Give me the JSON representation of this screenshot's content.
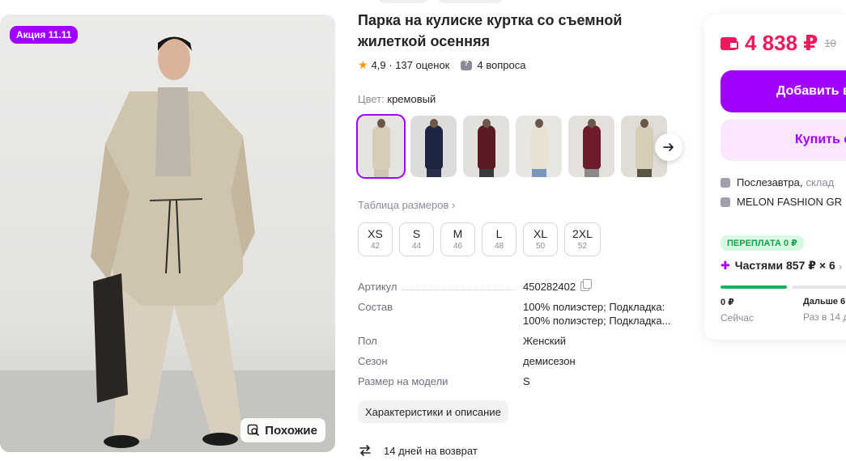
{
  "gallery": {
    "promo_badge": "Акция 11.11",
    "similar_label": "Похожие"
  },
  "product": {
    "title": "Парка на кулиске куртка со съемной жилеткой осенняя",
    "rating": "4,9",
    "reviews": "137 оценок",
    "questions": "4 вопроса",
    "color_label": "Цвет:",
    "color_value": "кремовый",
    "color_variants": [
      {
        "name": "cream",
        "body": "#d6cdb9",
        "legs": "#cfc6b3",
        "bg": "#e6e4e0"
      },
      {
        "name": "navy",
        "body": "#1e2540",
        "legs": "#26304d",
        "bg": "#dcdcdc"
      },
      {
        "name": "burgundy",
        "body": "#5a1a22",
        "legs": "#3a3a3a",
        "bg": "#e2e0dd"
      },
      {
        "name": "light-beige",
        "body": "#e8e2d4",
        "legs": "#7a96b8",
        "bg": "#e8e6e2"
      },
      {
        "name": "wine",
        "body": "#6e1b2c",
        "legs": "#8a8a8a",
        "bg": "#e4e1dd"
      },
      {
        "name": "cream-olive",
        "body": "#d8ceb8",
        "legs": "#5a5540",
        "bg": "#e0ddd6"
      }
    ],
    "size_table_label": "Таблица размеров ›",
    "sizes": [
      {
        "label": "XS",
        "num": "42"
      },
      {
        "label": "S",
        "num": "44"
      },
      {
        "label": "M",
        "num": "46"
      },
      {
        "label": "L",
        "num": "48"
      },
      {
        "label": "XL",
        "num": "50"
      },
      {
        "label": "2XL",
        "num": "52"
      }
    ],
    "specs": {
      "article_key": "Артикул",
      "article_val": "450282402",
      "composition_key": "Состав",
      "composition_val": "100% полиэстер; Подкладка: 100% полиэстер; Подкладка...",
      "gender_key": "Пол",
      "gender_val": "Женский",
      "season_key": "Сезон",
      "season_val": "демисезон",
      "model_size_key": "Размер на модели",
      "model_size_val": "S"
    },
    "description_button": "Характеристики и описание",
    "return_text": "14 дней на возврат"
  },
  "buy_panel": {
    "price": "4 838 ₽",
    "old_price": "10",
    "add_to_cart": "Добавить в",
    "buy_now": "Купить с",
    "delivery_when": "Послезавтра,",
    "delivery_where": "склад",
    "seller": "MELON FASHION GR",
    "overpay_badge": "ПЕРЕПЛАТА 0 ₽",
    "installment": "Частями 857 ₽ × 6",
    "installment_chevron": "›",
    "pay_now_amount": "0 ₽",
    "pay_now_label": "Сейчас",
    "pay_later_amount": "Дальше 6",
    "pay_later_label": "Раз в 14 д"
  },
  "colors": {
    "accent": "#a100ff",
    "price": "#f0195c",
    "success": "#16b45a"
  }
}
